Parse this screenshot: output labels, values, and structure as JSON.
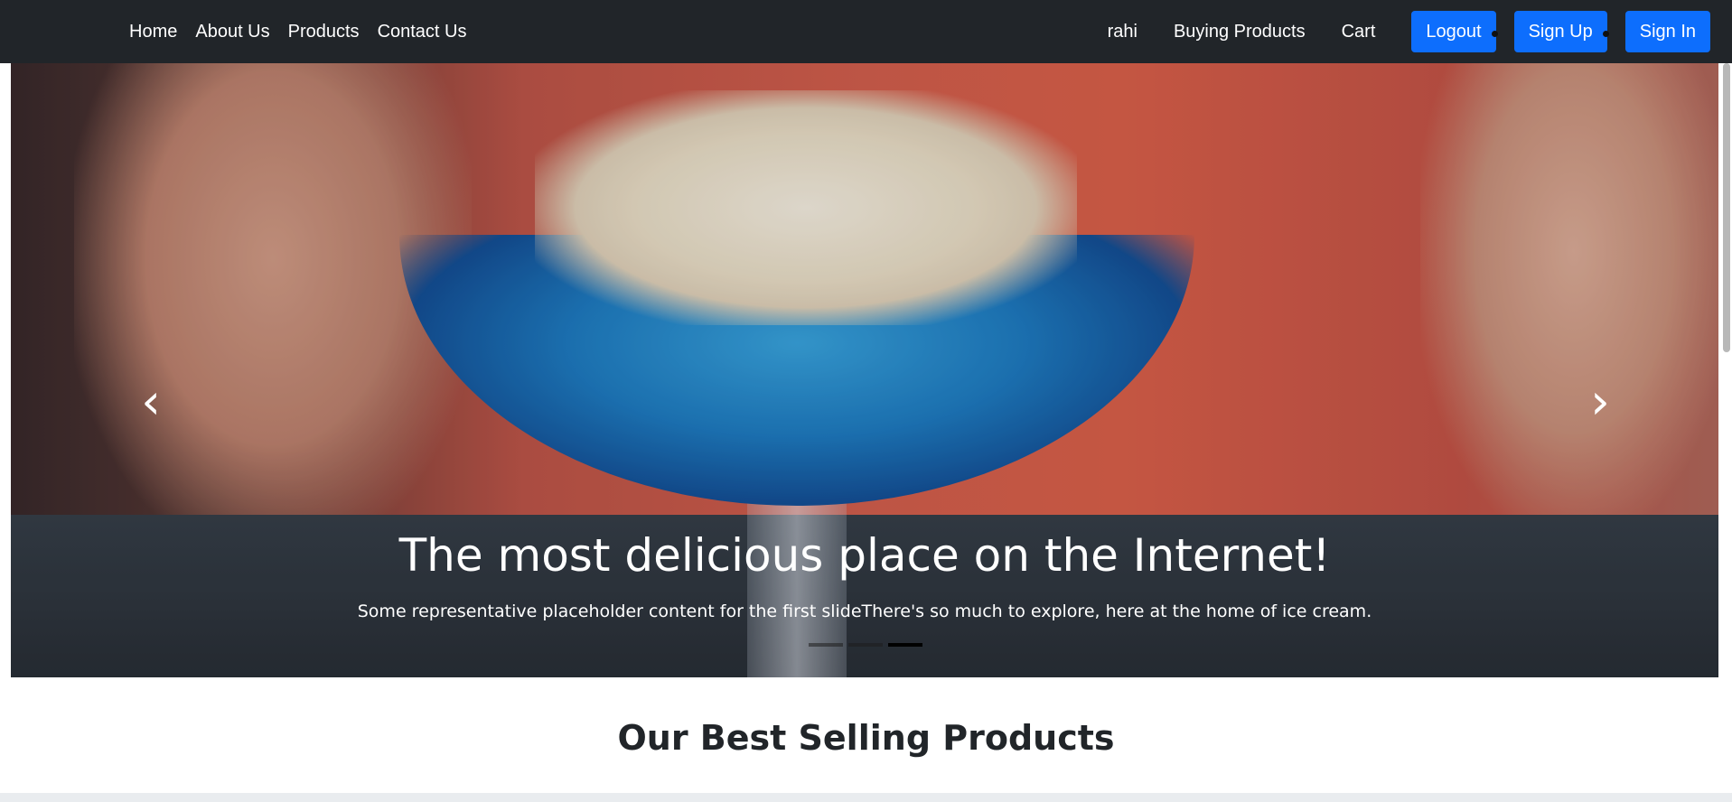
{
  "nav": {
    "left": [
      "Home",
      "About Us",
      "Products",
      "Contact Us"
    ],
    "user": "rahi",
    "buying": "Buying Products",
    "cart": "Cart",
    "logout": "Logout",
    "signup": "Sign Up",
    "signin": "Sign In",
    "button_color": "#0d6efd",
    "bar_color": "#212529"
  },
  "carousel": {
    "title": "The most delicious place on the Internet!",
    "text": "Some representative placeholder content for the first slideThere's so much to explore, here at the home of ice cream.",
    "prev_icon": "chevron-left-icon",
    "next_icon": "chevron-right-icon",
    "indicators": 3,
    "active_indicator": 3
  },
  "section": {
    "title": "Our Best Selling Products"
  }
}
